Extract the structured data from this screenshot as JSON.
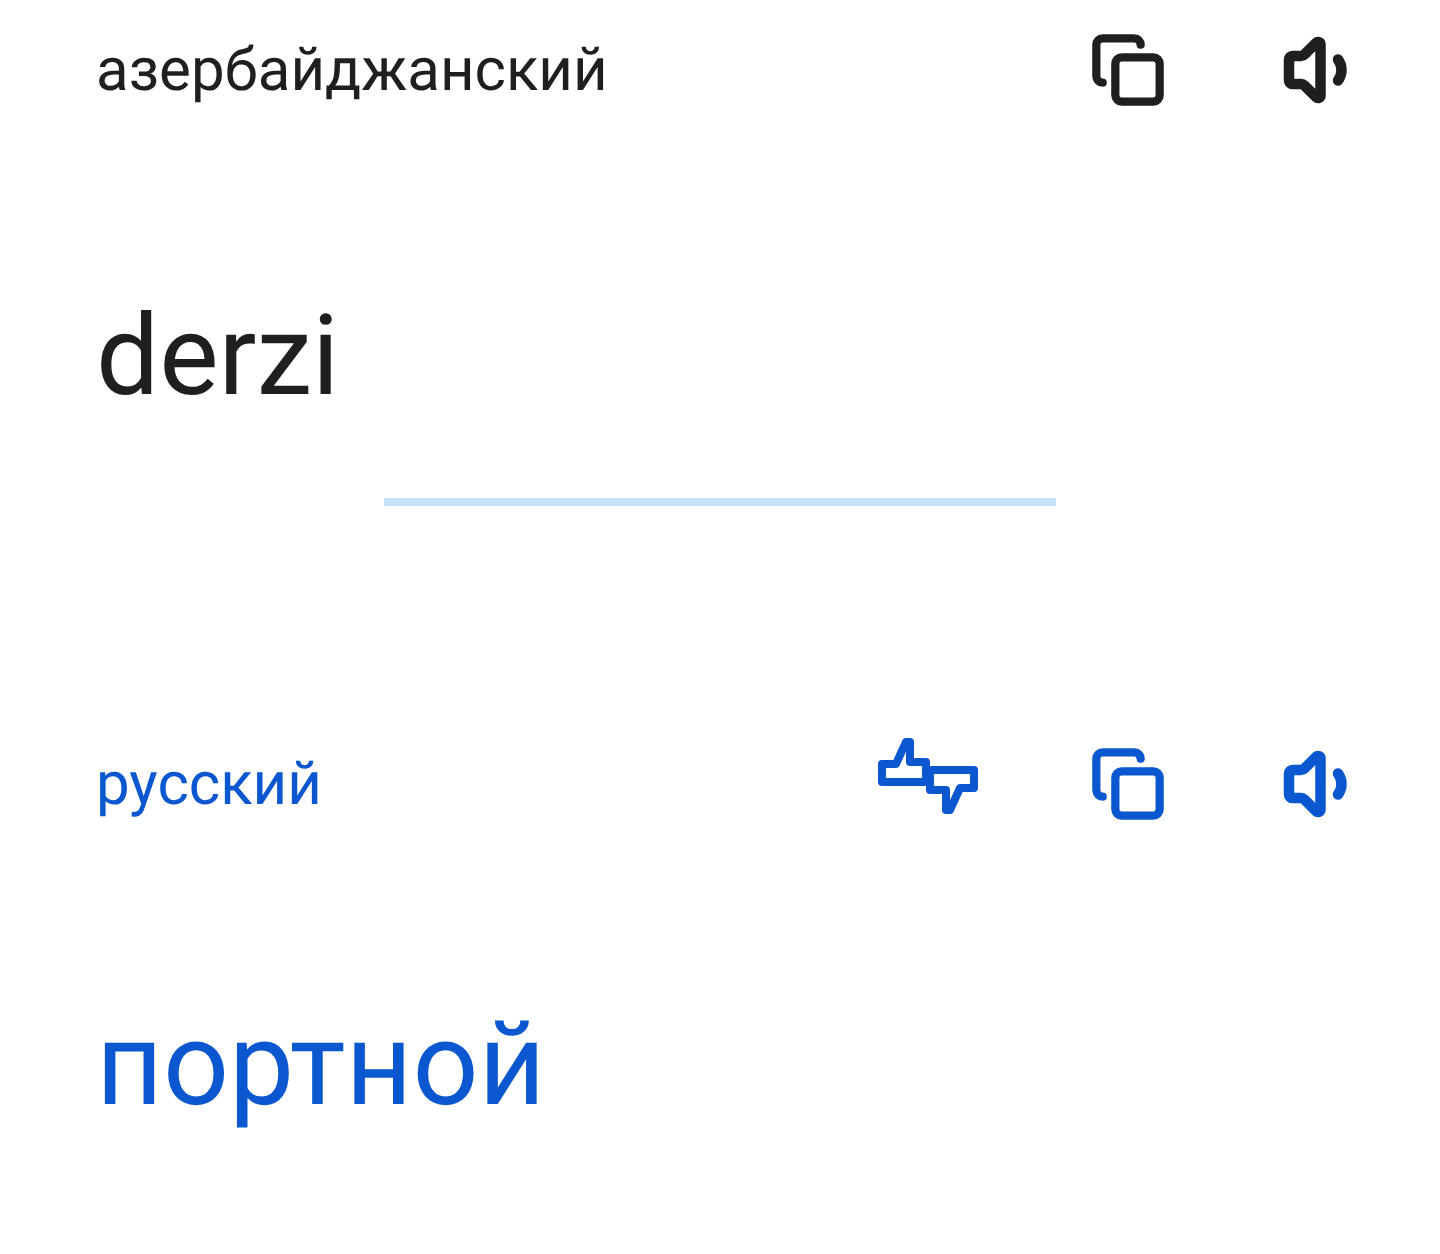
{
  "source": {
    "language": "азербайджанский",
    "text": "derzi"
  },
  "target": {
    "language": "русский",
    "text": "портной"
  }
}
